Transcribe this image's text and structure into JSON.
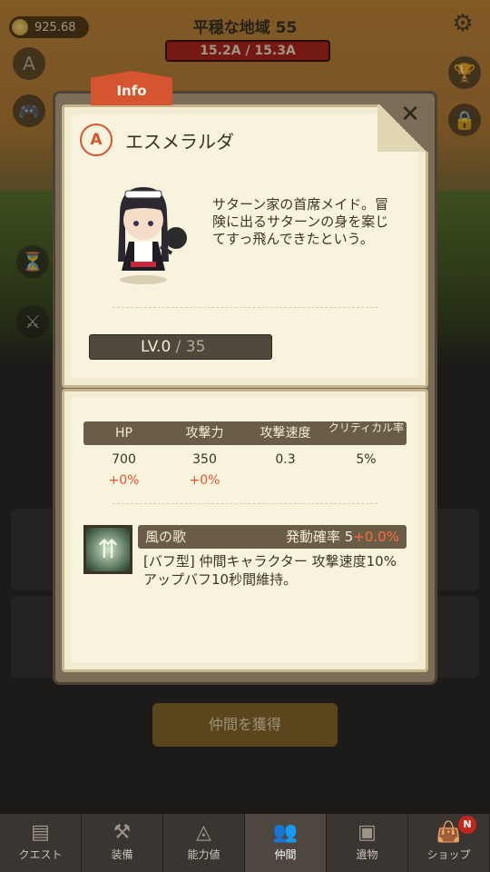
{
  "header": {
    "gold": "925.68",
    "stage_title": "平穏な地域 55",
    "stage_progress": "15.2A / 15.3A"
  },
  "modal": {
    "tab_label": "Info",
    "rank": "A",
    "hero_name": "エスメラルダ",
    "description": "サターン家の首席メイド。冒険に出るサターンの身を案じてすっ飛んできたという。",
    "level_label": "LV.0",
    "level_max": "/ 35",
    "stats": {
      "headers": [
        "HP",
        "攻撃力",
        "攻撃速度",
        "クリティカル率"
      ],
      "values": [
        "700",
        "350",
        "0.3",
        "5%"
      ],
      "bonuses": [
        "+0%",
        "+0%",
        "",
        ""
      ]
    },
    "skill": {
      "name": "風の歌",
      "rate_label": "発動確率",
      "rate_value": "5",
      "rate_bonus": "+0.0%",
      "description": "[バフ型] 仲間キャラクター 攻撃速度10%アップバフ10秒間維持。",
      "icon": "wind-arrows-icon"
    }
  },
  "behind": {
    "recruit_button": "仲間を獲得"
  },
  "bottom_nav": [
    {
      "label": "クエスト",
      "icon": "quest-book-icon"
    },
    {
      "label": "装備",
      "icon": "weapon-icon"
    },
    {
      "label": "能力値",
      "icon": "stats-icon"
    },
    {
      "label": "仲間",
      "icon": "party-icon",
      "active": true
    },
    {
      "label": "遺物",
      "icon": "chest-icon"
    },
    {
      "label": "ショップ",
      "icon": "shop-bag-icon",
      "badge": "N"
    }
  ]
}
